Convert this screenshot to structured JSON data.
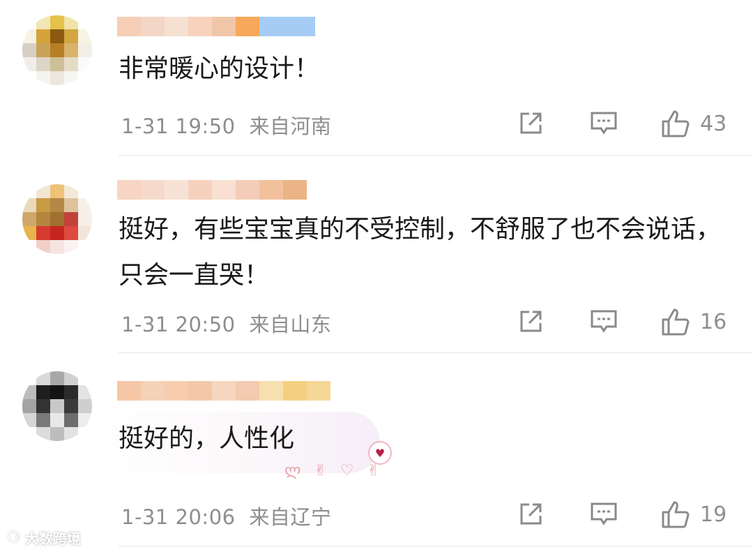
{
  "comments": [
    {
      "text": "非常暖心的设计！",
      "time": "1-31 19:50",
      "location": "来自河南",
      "likes": "43",
      "avatar_colors": [
        "#fdfdfd",
        "#f2e6b4",
        "#e6c24b",
        "#f1e3a9",
        "#ffffff",
        "#f6f2e4",
        "#d6a33a",
        "#8b5a12",
        "#d2a640",
        "#f8f3e3",
        "#d8cfc4",
        "#c9a35a",
        "#b77f25",
        "#d8b36a",
        "#f4efe6",
        "#f1eee9",
        "#ddd5c6",
        "#cfbf96",
        "#e5dcc8",
        "#fafafa",
        "#ffffff",
        "#f5f3ef",
        "#ece7dd",
        "#f7f5f2",
        "#ffffff"
      ],
      "name_colors": [
        "#f6cfb6",
        "#f3d7c6",
        "#f5e0d2",
        "#f8d2bd",
        "#f1c6a8",
        "#f7a85a",
        "#a6ccf5"
      ]
    },
    {
      "text": "挺好，有些宝宝真的不受控制，不舒服了也不会说话，只会一直哭！",
      "time": "1-31 20:50",
      "location": "来自山东",
      "likes": "16",
      "avatar_colors": [
        "#ffffff",
        "#f1e6d2",
        "#efc27a",
        "#f4e9d7",
        "#ffffff",
        "#ead8b8",
        "#c89a45",
        "#b48845",
        "#dec39c",
        "#f6f0e6",
        "#cfa76a",
        "#b3873d",
        "#a07030",
        "#c2423a",
        "#f5efe8",
        "#e7b34a",
        "#d53a2f",
        "#c5261f",
        "#dd4a3e",
        "#f3e4dc",
        "#ffffff",
        "#f1cfc7",
        "#f6e4e0",
        "#f9f2f0",
        "#ffffff"
      ],
      "name_colors": [
        "#f7d4c4",
        "#f5dacb",
        "#f8e2d6",
        "#f6d1be",
        "#f9e0d3",
        "#f4cdb8",
        "#f2c09c",
        "#eab486"
      ]
    },
    {
      "text": "挺好的，人性化",
      "time": "1-31 20:06",
      "location": "来自辽宁",
      "likes": "19",
      "avatar_colors": [
        "#ffffff",
        "#d9d9d9",
        "#a8a8a8",
        "#d0d0d0",
        "#ffffff",
        "#bdbdbd",
        "#1e1e1e",
        "#141414",
        "#2b2b2b",
        "#e3e3e3",
        "#a3a3a3",
        "#333333",
        "#c8c8c8",
        "#3a3a3a",
        "#cfcfcf",
        "#d6d6d6",
        "#7a7a7a",
        "#e8e8e8",
        "#6c6c6c",
        "#ededed",
        "#ffffff",
        "#dcdcdc",
        "#bdbdbd",
        "#e2e2e2",
        "#ffffff"
      ],
      "name_colors": [
        "#f6c7a6",
        "#f5d2b8",
        "#f8cdaf",
        "#f3c8a9",
        "#f7d6bf",
        "#f4cab0",
        "#f6e0b0",
        "#f3cf80",
        "#f5d798"
      ]
    }
  ],
  "stickers": "ლ ✌ ♡ ✌",
  "watermark": {
    "logo": "⚆",
    "text": "大数跨境"
  }
}
